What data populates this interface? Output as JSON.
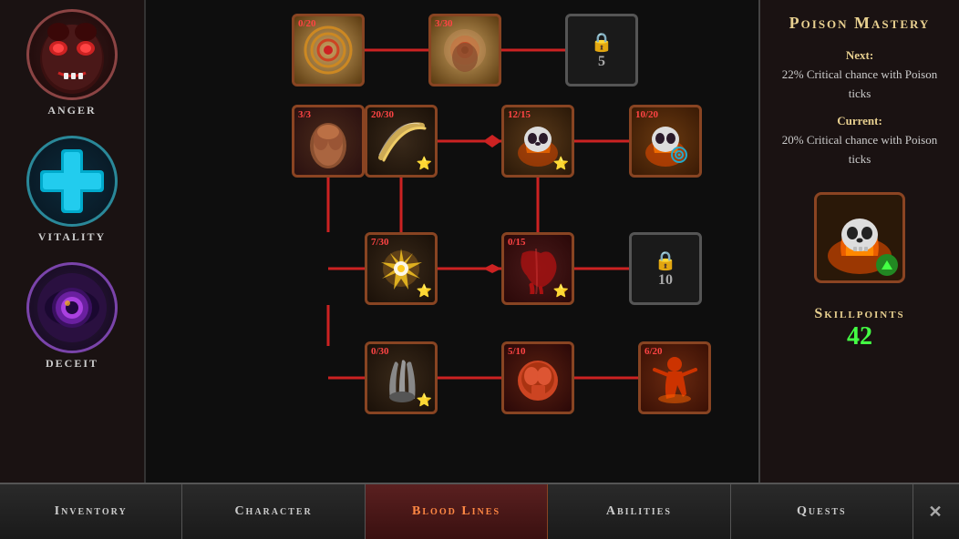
{
  "title": "Blood Lines",
  "sidebar": {
    "items": [
      {
        "id": "anger",
        "label": "Anger"
      },
      {
        "id": "vitality",
        "label": "Vitality"
      },
      {
        "id": "deceit",
        "label": "Deceit"
      }
    ]
  },
  "skill_tree": {
    "nodes": [
      {
        "id": "node-top-1",
        "count": "0/20",
        "locked": false,
        "star": false,
        "type": "target"
      },
      {
        "id": "node-top-2",
        "count": "3/30",
        "locked": false,
        "star": false,
        "type": "target2"
      },
      {
        "id": "node-top-3",
        "locked": true,
        "lock_count": "5",
        "type": "locked"
      },
      {
        "id": "node-mid1-1",
        "count": "20/30",
        "locked": false,
        "star": true,
        "type": "slash"
      },
      {
        "id": "node-mid1-2",
        "count": "12/15",
        "locked": false,
        "star": true,
        "type": "skull1"
      },
      {
        "id": "node-mid1-3",
        "count": "10/20",
        "locked": false,
        "star": false,
        "type": "skull2",
        "target_circle": true
      },
      {
        "id": "node-arm",
        "count": "3/3",
        "locked": false,
        "star": false,
        "type": "arm"
      },
      {
        "id": "node-mid2-1",
        "count": "7/30",
        "locked": false,
        "star": true,
        "type": "burst"
      },
      {
        "id": "node-mid2-2",
        "count": "0/15",
        "locked": false,
        "star": true,
        "type": "blob"
      },
      {
        "id": "node-mid2-3",
        "locked": true,
        "lock_count": "10",
        "type": "locked"
      },
      {
        "id": "node-bot-1",
        "count": "0/30",
        "locked": false,
        "star": true,
        "type": "claw"
      },
      {
        "id": "node-bot-2",
        "count": "5/10",
        "locked": false,
        "star": false,
        "type": "muscle"
      },
      {
        "id": "node-bot-3",
        "count": "6/20",
        "locked": false,
        "star": false,
        "type": "shadow"
      }
    ]
  },
  "right_panel": {
    "title": "Poison Mastery",
    "description_next_label": "Next:",
    "description_next": "22% Critical chance with Poison ticks",
    "description_current_label": "Current:",
    "description_current": "20% Critical chance with Poison ticks",
    "skillpoints_label": "Skillpoints",
    "skillpoints_value": "42"
  },
  "nav": {
    "items": [
      {
        "id": "inventory",
        "label": "Inventory",
        "active": false
      },
      {
        "id": "character",
        "label": "Character",
        "active": false
      },
      {
        "id": "blood-lines",
        "label": "Blood Lines",
        "active": true
      },
      {
        "id": "abilities",
        "label": "Abilities",
        "active": false
      },
      {
        "id": "quests",
        "label": "Quests",
        "active": false
      }
    ],
    "close_label": "✕"
  }
}
